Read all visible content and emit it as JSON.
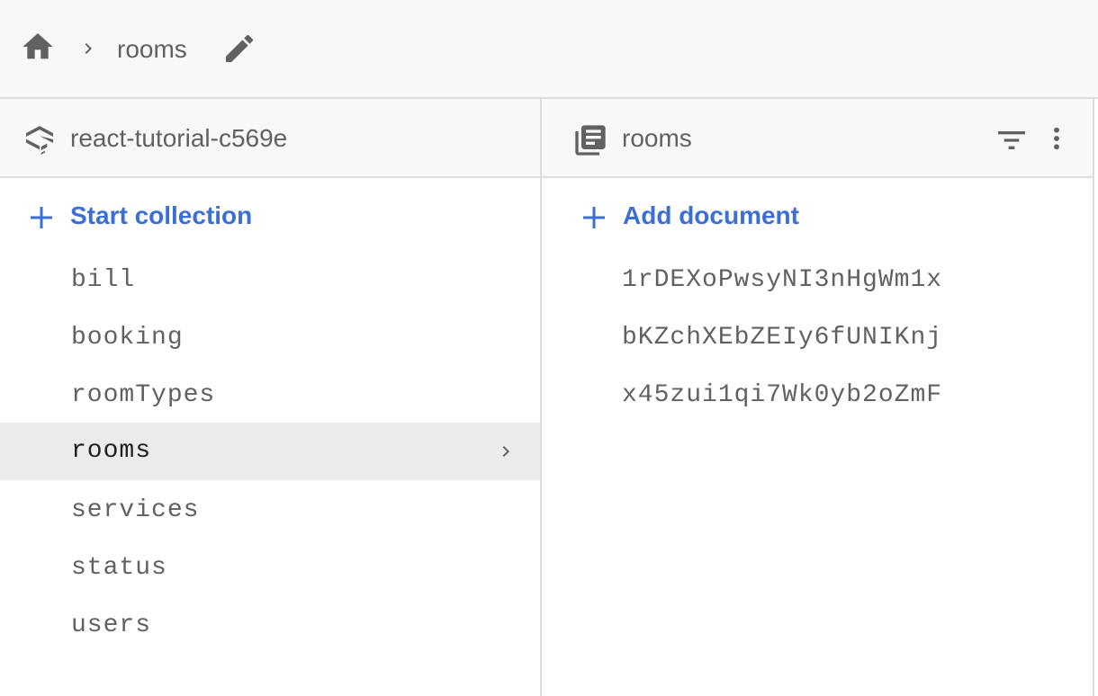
{
  "breadcrumb": {
    "path_label": "rooms"
  },
  "left_panel": {
    "project_name": "react-tutorial-c569e",
    "add_label": "Start collection",
    "collections": [
      {
        "label": "bill"
      },
      {
        "label": "booking"
      },
      {
        "label": "roomTypes"
      },
      {
        "label": "rooms"
      },
      {
        "label": "services"
      },
      {
        "label": "status"
      },
      {
        "label": "users"
      }
    ],
    "selected_index": 3
  },
  "right_panel": {
    "collection_name": "rooms",
    "add_label": "Add document",
    "documents": [
      {
        "label": "1rDEXoPwsyNI3nHgWm1x"
      },
      {
        "label": "bKZchXEbZEIy6fUNIKnj"
      },
      {
        "label": "x45zui1qi7Wk0yb2oZmF"
      }
    ]
  },
  "icons": {
    "home": "home-icon",
    "chevron": "chevron-right-icon",
    "edit": "pencil-icon",
    "project": "firestore-stack-icon",
    "collection": "collection-stack-icon",
    "filter": "filter-icon",
    "more": "more-vert-icon",
    "add": "plus-icon"
  },
  "colors": {
    "accent": "#3b6fd6",
    "text_muted": "#616161",
    "selected_bg": "#ebebeb",
    "header_bg": "#f8f8f8"
  }
}
